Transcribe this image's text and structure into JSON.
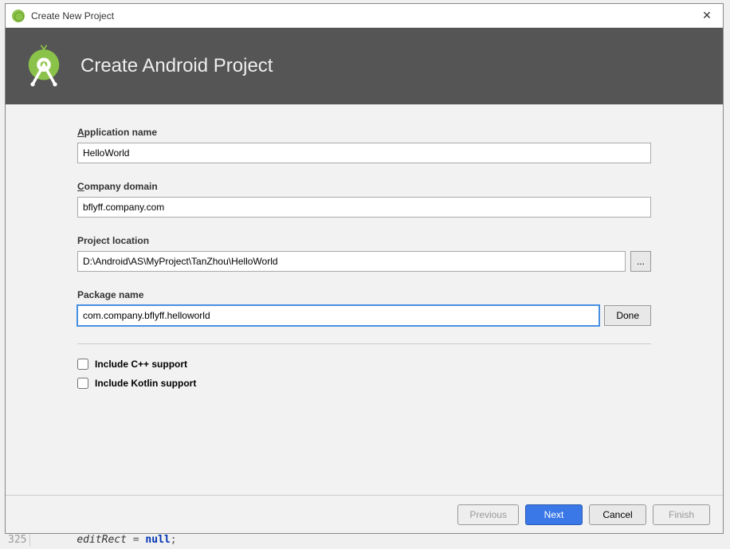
{
  "window": {
    "title": "Create New Project",
    "close_symbol": "✕"
  },
  "header": {
    "title": "Create Android Project"
  },
  "fields": {
    "app_name": {
      "label": "Application name",
      "value": "HelloWorld"
    },
    "company_domain": {
      "label": "Company domain",
      "value": "bflyff.company.com"
    },
    "project_location": {
      "label": "Project location",
      "value": "D:\\Android\\AS\\MyProject\\TanZhou\\HelloWorld",
      "browse": "..."
    },
    "package_name": {
      "label": "Package name",
      "value": "com.company.bflyff.helloworld",
      "done": "Done"
    }
  },
  "checkboxes": {
    "cpp": "Include C++ support",
    "kotlin": "Include Kotlin support"
  },
  "footer": {
    "previous": "Previous",
    "next": "Next",
    "cancel": "Cancel",
    "finish": "Finish"
  },
  "background": {
    "line_number": "325",
    "code_html": "editRect = null;"
  }
}
